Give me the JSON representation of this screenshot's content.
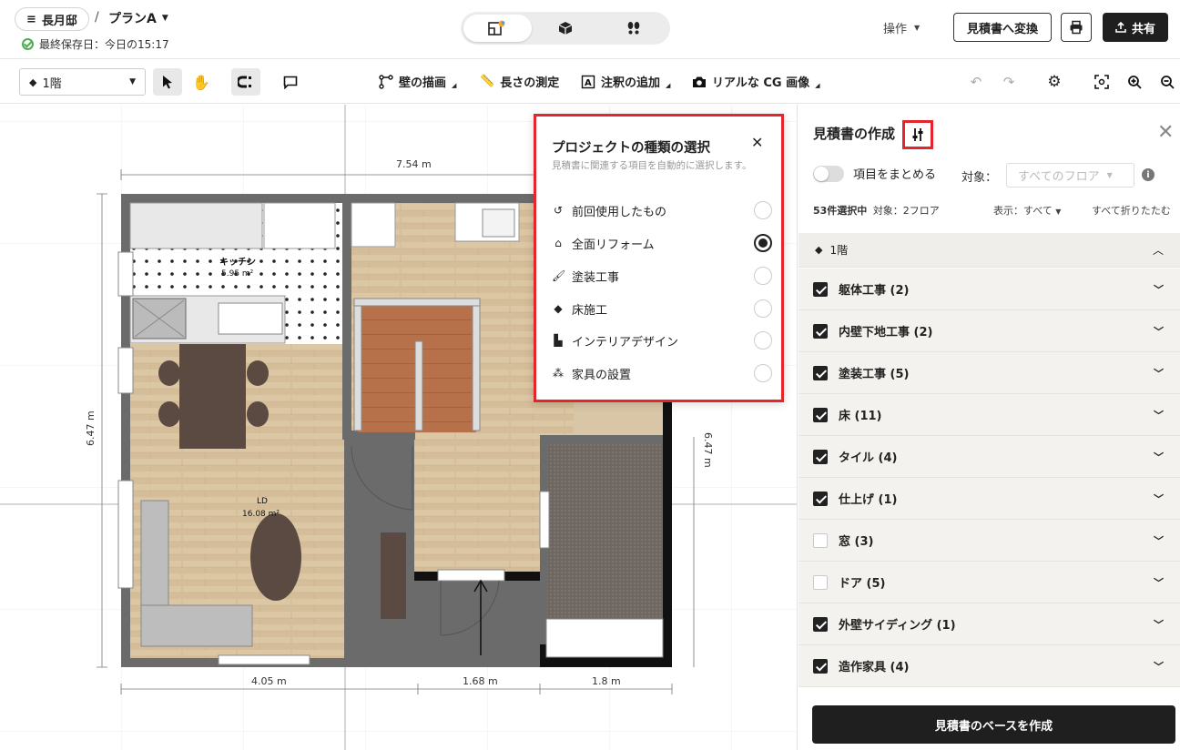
{
  "header": {
    "project_name": "長月邸",
    "separator": "/",
    "plan_name": "プランA",
    "saved_status": "最終保存日：今日の15:17",
    "operations_label": "操作",
    "convert_button": "見積書へ変換",
    "share_button": "共有"
  },
  "toolbar": {
    "floor_select": "1階",
    "tools": [
      {
        "label": "壁の描画"
      },
      {
        "label": "長さの測定"
      },
      {
        "label": "注釈の追加"
      },
      {
        "label": "リアルな CG 画像"
      }
    ]
  },
  "floorplan": {
    "kitchen_label": "キッチン",
    "kitchen_area": "5.95 m²",
    "ld_label": "LD",
    "ld_area": "16.08 m²",
    "dim_top": "7.54 m",
    "dim_left": "6.47 m",
    "dim_right": "6.47 m",
    "dim_bottom_1": "4.05 m",
    "dim_bottom_2": "1.68 m",
    "dim_bottom_3": "1.8 m"
  },
  "popup": {
    "title": "プロジェクトの種類の選択",
    "subtitle": "見積書に関連する項目を自動的に選択します。",
    "options": [
      {
        "label": "前回使用したもの",
        "icon": "history-icon",
        "selected": false
      },
      {
        "label": "全面リフォーム",
        "icon": "house-icon",
        "selected": true
      },
      {
        "label": "塗装工事",
        "icon": "paint-brush-icon",
        "selected": false
      },
      {
        "label": "床施工",
        "icon": "layers-icon",
        "selected": false
      },
      {
        "label": "インテリアデザイン",
        "icon": "interior-icon",
        "selected": false
      },
      {
        "label": "家具の設置",
        "icon": "furniture-icon",
        "selected": false
      }
    ]
  },
  "panel": {
    "title": "見積書の作成",
    "group_toggle_label": "項目をまとめる",
    "target_label": "対象：",
    "target_value": "すべてのフロア",
    "selected_count": "53件選択中",
    "selected_target": "対象：2フロア",
    "display_filter": "表示：すべて",
    "collapse_all": "すべて折りたたむ",
    "floor_header": "1階",
    "categories": [
      {
        "label": "躯体工事 (2)",
        "checked": true
      },
      {
        "label": "内壁下地工事 (2)",
        "checked": true
      },
      {
        "label": "塗装工事 (5)",
        "checked": true
      },
      {
        "label": "床 (11)",
        "checked": true
      },
      {
        "label": "タイル (4)",
        "checked": true
      },
      {
        "label": "仕上げ (1)",
        "checked": true
      },
      {
        "label": "窓 (3)",
        "checked": false
      },
      {
        "label": "ドア (5)",
        "checked": false
      },
      {
        "label": "外壁サイディング (1)",
        "checked": true
      },
      {
        "label": "造作家具 (4)",
        "checked": true
      }
    ],
    "create_button": "見積書のベースを作成"
  },
  "colors": {
    "accent_red": "#e3262c",
    "dark": "#1f1f1f",
    "panel_bg": "#f4f2ee"
  }
}
